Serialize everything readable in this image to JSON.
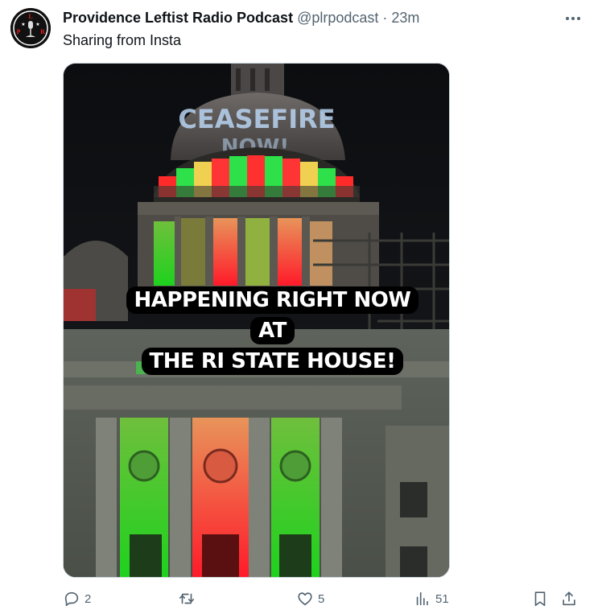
{
  "tweet": {
    "author_name": "Providence Leftist Radio Podcast",
    "author_handle": "@plrpodcast",
    "separator": "·",
    "time": "23m",
    "text": "Sharing from Insta",
    "avatar_letters": [
      "L",
      "P",
      "R"
    ]
  },
  "media": {
    "overlay_caption_line1": "HAPPENING RIGHT NOW AT",
    "overlay_caption_line2": "THE RI STATE HOUSE!",
    "projection_line1": "CEASEFIRE",
    "projection_line2": "NOW!"
  },
  "actions": {
    "reply_count": "2",
    "repost_count": "",
    "like_count": "5",
    "views_count": "51"
  },
  "icons": {
    "more": "more-horizontal-icon",
    "reply": "reply-icon",
    "repost": "repost-icon",
    "like": "heart-icon",
    "views": "analytics-icon",
    "bookmark": "bookmark-icon",
    "share": "share-icon"
  },
  "colors": {
    "text_primary": "#0f1419",
    "text_secondary": "#536471",
    "light_green": "#2ecc40",
    "light_red": "#ff2a2a"
  }
}
